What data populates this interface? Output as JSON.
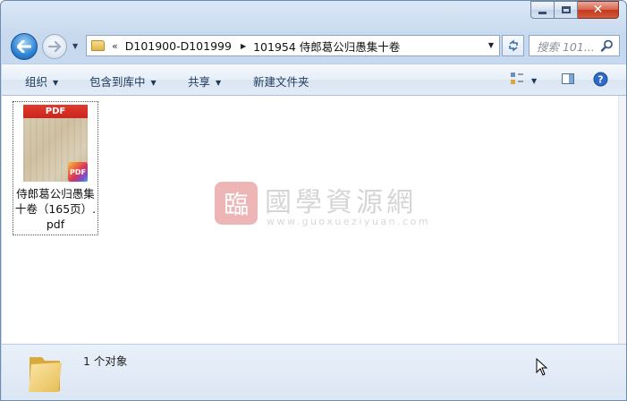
{
  "window": {
    "caption_min": "minimize",
    "caption_max": "maximize",
    "caption_close": "close"
  },
  "address": {
    "chevron": "«",
    "segments": [
      "D101900-D101999",
      "101954 侍郎葛公归愚集十卷"
    ],
    "separator": "▸"
  },
  "search": {
    "placeholder": "搜索 101..."
  },
  "commands": {
    "organize": "组织",
    "include_library": "包含到库中",
    "share": "共享",
    "new_folder": "新建文件夹"
  },
  "file": {
    "thumb_label": "PDF",
    "badge_label": "PDF",
    "name": "侍郎葛公归愚集十卷（165页）.pdf"
  },
  "watermark": {
    "seal": "臨",
    "title": "國學資源網",
    "url": "www.guoxueziyuan.com"
  },
  "details": {
    "count_text": "1 个对象"
  },
  "colors": {
    "accent": "#1e395b",
    "selection_border": "#555555",
    "pdf_red": "#d0291f"
  }
}
